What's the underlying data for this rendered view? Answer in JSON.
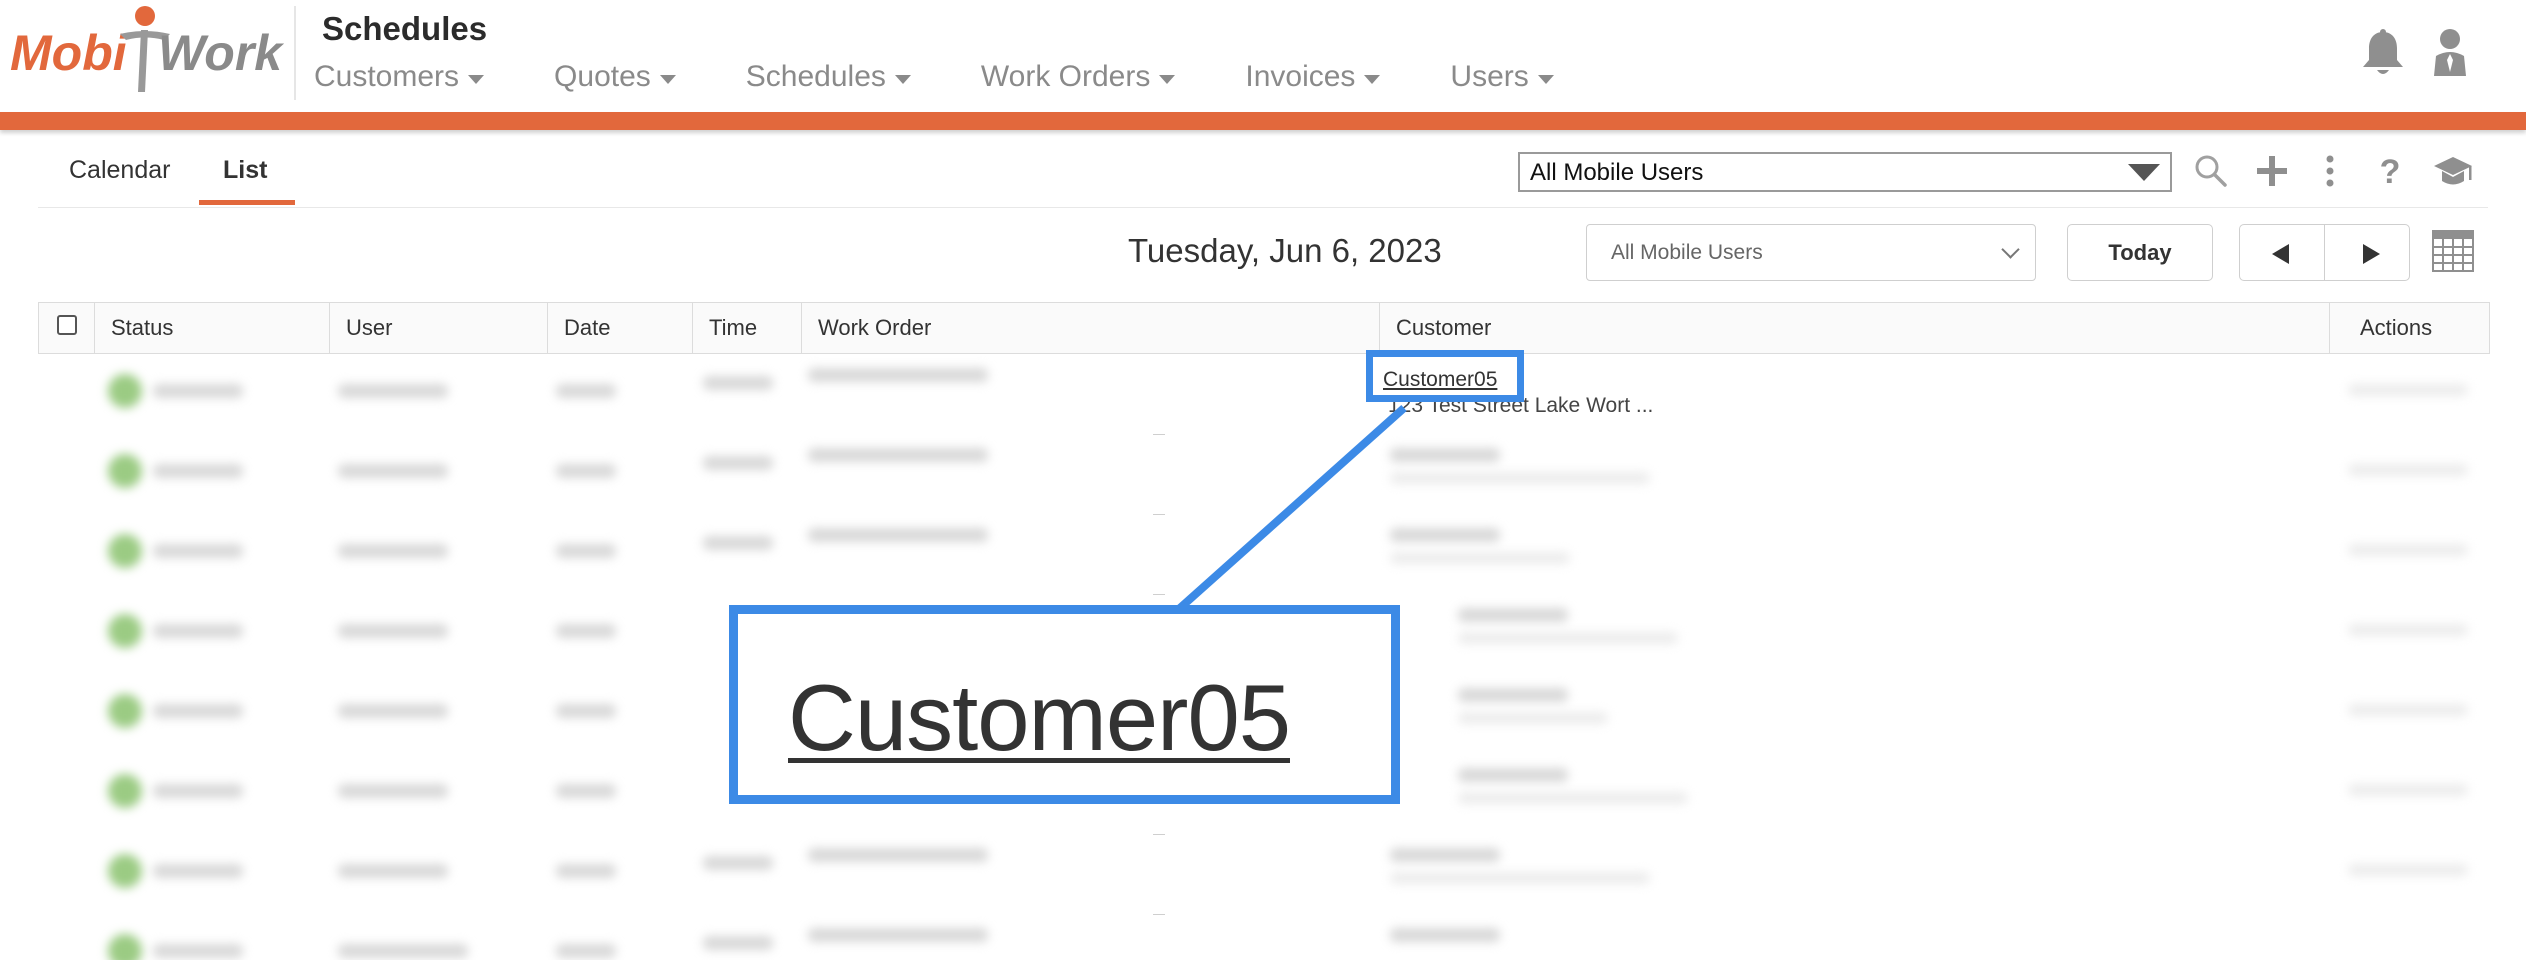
{
  "app": {
    "brand": "MobiWork",
    "brand_parts": [
      "Mobi",
      "Work"
    ],
    "module_title": "Schedules"
  },
  "nav": {
    "items": [
      {
        "label": "Customers"
      },
      {
        "label": "Quotes"
      },
      {
        "label": "Schedules"
      },
      {
        "label": "Work Orders"
      },
      {
        "label": "Invoices"
      },
      {
        "label": "Users"
      }
    ]
  },
  "header_icons": [
    "bell-icon",
    "user-profile-icon"
  ],
  "tabs": [
    {
      "label": "Calendar",
      "active": false
    },
    {
      "label": "List",
      "active": true
    }
  ],
  "toolbar": {
    "user_filter": "All Mobile Users",
    "icons": [
      "search-icon",
      "plus-icon",
      "more-vertical-icon",
      "help-icon",
      "graduation-cap-icon"
    ]
  },
  "date_bar": {
    "date": "Tuesday, Jun 6, 2023",
    "user_filter": "All Mobile Users",
    "today_label": "Today"
  },
  "table": {
    "columns": [
      "Status",
      "User",
      "Date",
      "Time",
      "Work Order",
      "Customer",
      "Actions"
    ],
    "first_row": {
      "customer_name": "Customer05",
      "customer_address": "123 Test Street  Lake Wort ..."
    }
  },
  "callout": {
    "zoom_text": "Customer05"
  },
  "colors": {
    "accent": "#e2683c",
    "highlight": "#3c8ae6",
    "status_green": "#8cc46e"
  }
}
